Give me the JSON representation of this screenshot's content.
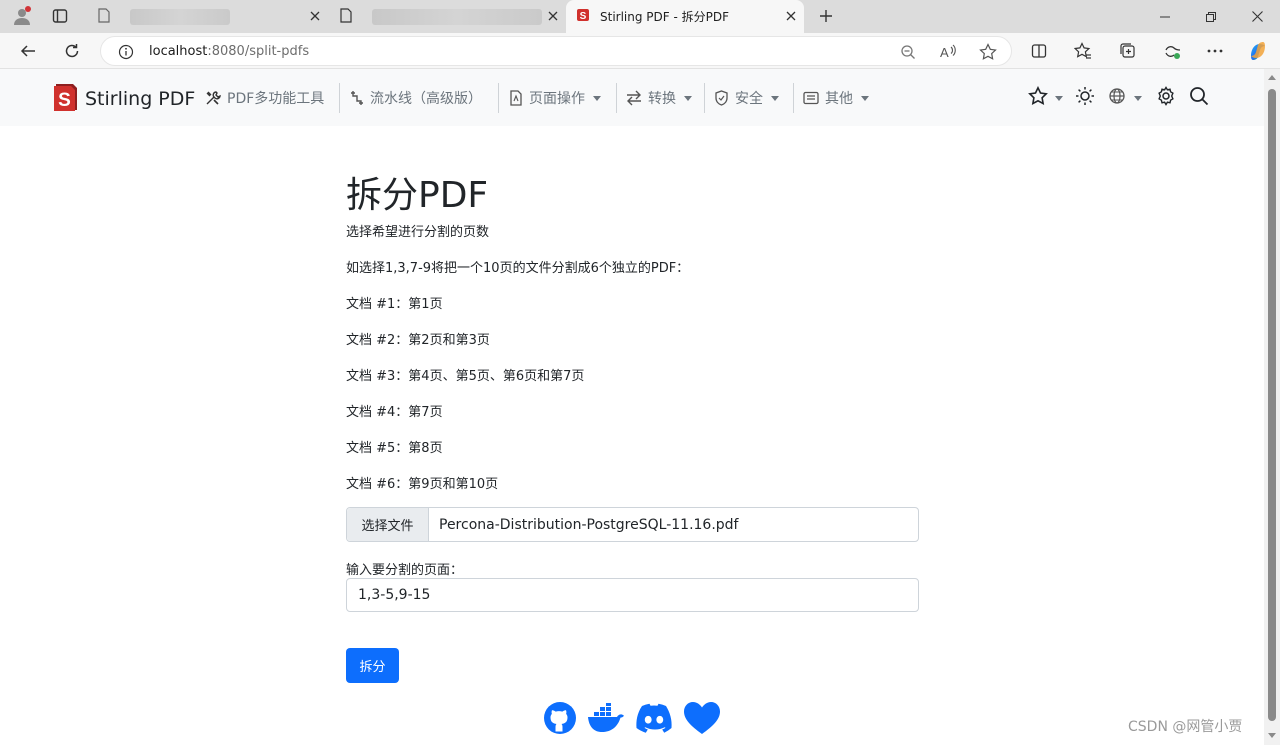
{
  "browser": {
    "tabs": [
      {
        "title": "",
        "active": false
      },
      {
        "title": "",
        "active": false
      },
      {
        "title": "Stirling PDF - 拆分PDF",
        "active": true
      }
    ],
    "url": {
      "host": "localhost",
      "path": ":8080/split-pdfs"
    }
  },
  "navbar": {
    "brand": "Stirling PDF",
    "items": [
      {
        "label": "PDF多功能工具",
        "icon": "tools-icon",
        "dropdown": false
      },
      {
        "label": "流水线（高级版）",
        "icon": "pipeline-icon",
        "dropdown": false
      },
      {
        "label": "页面操作",
        "icon": "file-icon",
        "dropdown": true
      },
      {
        "label": "转换",
        "icon": "arrows-icon",
        "dropdown": true
      },
      {
        "label": "安全",
        "icon": "shield-icon",
        "dropdown": true
      },
      {
        "label": "其他",
        "icon": "card-icon",
        "dropdown": true
      }
    ],
    "right_icons": [
      "star-icon",
      "sun-icon",
      "globe-icon",
      "gear-icon",
      "search-icon"
    ]
  },
  "main": {
    "title": "拆分PDF",
    "lines": [
      "选择希望进行分割的页数",
      "如选择1,3,7-9将把一个10页的文件分割成6个独立的PDF：",
      "文档 #1：第1页",
      "文档 #2：第2页和第3页",
      "文档 #3：第4页、第5页、第6页和第7页",
      "文档 #4：第7页",
      "文档 #5：第8页",
      "文档 #6：第9页和第10页"
    ],
    "file_button": "选择文件",
    "file_name": "Percona-Distribution-PostgreSQL-11.16.pdf",
    "pages_label": "输入要分割的页面：",
    "pages_value": "1,3-5,9-15",
    "submit_label": "拆分"
  },
  "footer": {
    "icons": [
      "github-icon",
      "docker-icon",
      "discord-icon",
      "heart-icon"
    ]
  },
  "watermark": "CSDN @网管小贾",
  "colors": {
    "primary": "#0d6efd",
    "navbar_bg": "#f8f9fa",
    "brand_red": "#d0312d"
  }
}
